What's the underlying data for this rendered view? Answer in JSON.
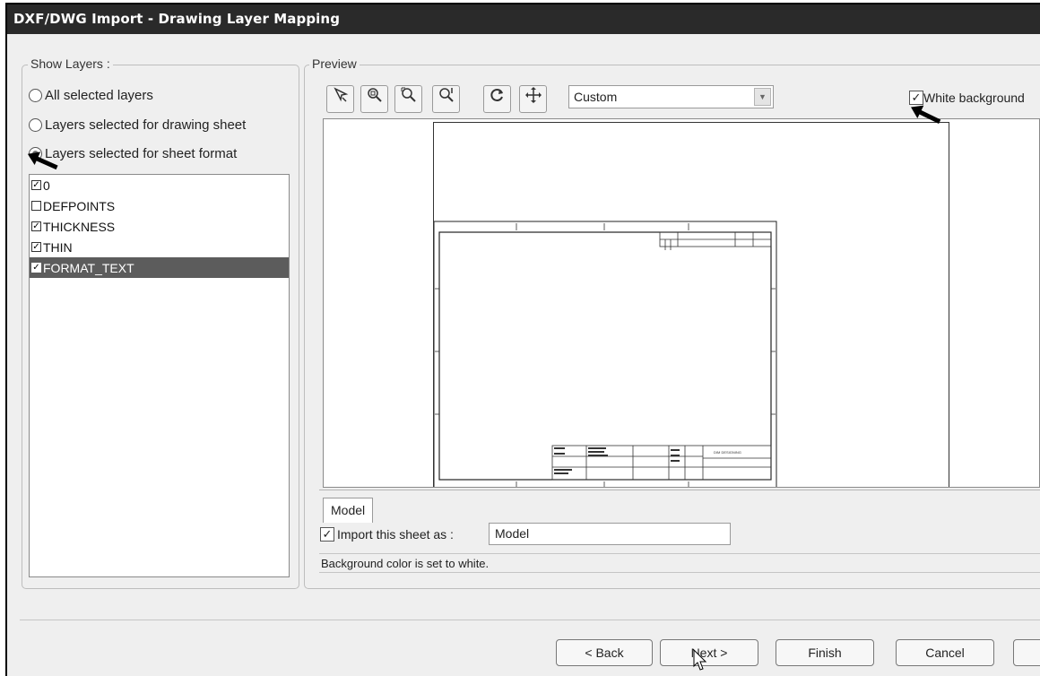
{
  "window": {
    "title": "DXF/DWG Import - Drawing Layer Mapping"
  },
  "show_layers": {
    "label": "Show Layers :",
    "options": [
      {
        "label": "All selected layers",
        "selected": false
      },
      {
        "label": "Layers selected for drawing sheet",
        "selected": false
      },
      {
        "label": "Layers selected for sheet format",
        "selected": true
      }
    ],
    "layers": [
      {
        "name": "0",
        "checked": true
      },
      {
        "name": "DEFPOINTS",
        "checked": false
      },
      {
        "name": "THICKNESS",
        "checked": true
      },
      {
        "name": "THIN",
        "checked": true
      },
      {
        "name": "FORMAT_TEXT",
        "checked": true
      }
    ]
  },
  "preview": {
    "label": "Preview",
    "toolbar_icons": [
      "select-icon",
      "zoom-fit-icon",
      "zoom-window-icon",
      "zoom-in-out-icon",
      "rotate-icon",
      "pan-icon"
    ],
    "zoom_value": "Custom",
    "white_background_label": "White background",
    "white_background_checked": true,
    "title_block_text": "DIM DESIGNING"
  },
  "tabs": [
    {
      "label": "Model"
    }
  ],
  "import_sheet": {
    "label": "Import this sheet as :",
    "checked": true,
    "value": "Model"
  },
  "status": "Background color is set to white.",
  "buttons": {
    "back": "< Back",
    "next": "Next >",
    "finish": "Finish",
    "cancel": "Cancel"
  }
}
